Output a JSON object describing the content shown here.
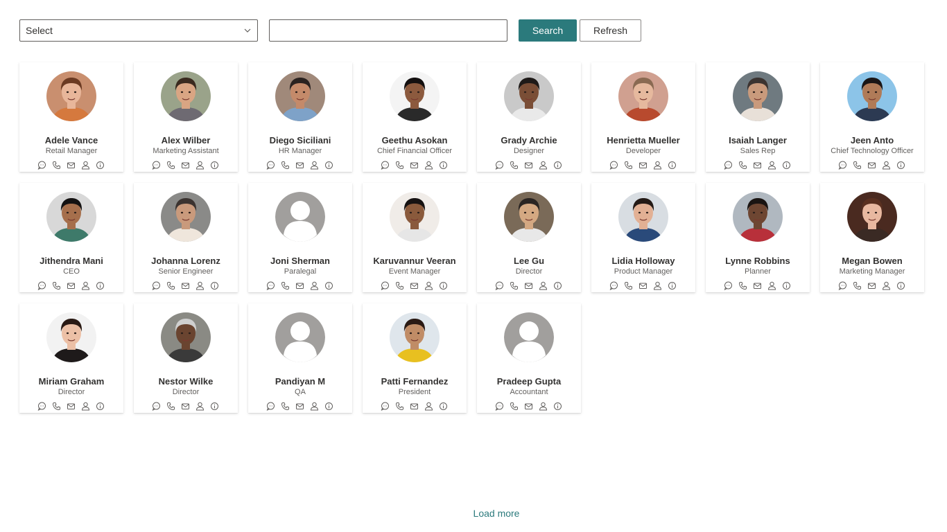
{
  "filter": {
    "select_label": "Select",
    "search_value": "",
    "search_button": "Search",
    "refresh_button": "Refresh"
  },
  "colors": {
    "accent": "#2b7a7c",
    "placeholder_avatar": "#a19f9d"
  },
  "card_actions": [
    "chat-icon",
    "phone-icon",
    "mail-icon",
    "person-icon",
    "info-icon"
  ],
  "people": [
    {
      "name": "Adele Vance",
      "role": "Retail Manager",
      "photo": true,
      "skin": "#e8b69a",
      "hair": "#6b3a22",
      "shirt": "#d5793e",
      "bg": "#c98f6f"
    },
    {
      "name": "Alex Wilber",
      "role": "Marketing Assistant",
      "photo": true,
      "skin": "#d9a583",
      "hair": "#3a2a1f",
      "shirt": "#6e6a72",
      "bg": "#9aa38a"
    },
    {
      "name": "Diego Siciliani",
      "role": "HR Manager",
      "photo": true,
      "skin": "#c48a6a",
      "hair": "#2a2220",
      "shirt": "#7ea2c8",
      "bg": "#a0897a"
    },
    {
      "name": "Geethu Asokan",
      "role": "Chief Financial Officer",
      "photo": true,
      "skin": "#8c5a3e",
      "hair": "#141010",
      "shirt": "#2a2a2a",
      "bg": "#f4f4f4"
    },
    {
      "name": "Grady Archie",
      "role": "Designer",
      "photo": true,
      "skin": "#7a4e36",
      "hair": "#1e1a18",
      "shirt": "#e9e9e9",
      "bg": "#c9c9c9"
    },
    {
      "name": "Henrietta Mueller",
      "role": "Developer",
      "photo": true,
      "skin": "#e6b99e",
      "hair": "#8a6a52",
      "shirt": "#b84a2e",
      "bg": "#d0a090"
    },
    {
      "name": "Isaiah Langer",
      "role": "Sales Rep",
      "photo": true,
      "skin": "#c99a7c",
      "hair": "#3b3330",
      "shirt": "#e8e0d8",
      "bg": "#6f7a80"
    },
    {
      "name": "Jeen Anto",
      "role": "Chief Technology Officer",
      "photo": true,
      "skin": "#b07b58",
      "hair": "#1a1616",
      "shirt": "#2c3a52",
      "bg": "#8cc4e8"
    },
    {
      "name": "Jithendra Mani",
      "role": "CEO",
      "photo": true,
      "skin": "#a66f4c",
      "hair": "#141212",
      "shirt": "#3e7a6a",
      "bg": "#d8d8d8"
    },
    {
      "name": "Johanna Lorenz",
      "role": "Senior Engineer",
      "photo": true,
      "skin": "#c99a7c",
      "hair": "#3b3330",
      "shirt": "#efe6dc",
      "bg": "#8a8a88"
    },
    {
      "name": "Joni Sherman",
      "role": "Paralegal",
      "photo": false
    },
    {
      "name": "Karuvannur Veeran",
      "role": "Event Manager",
      "photo": true,
      "skin": "#8a5a3c",
      "hair": "#161212",
      "shirt": "#e6e6e6",
      "bg": "#f0ece8"
    },
    {
      "name": "Lee Gu",
      "role": "Director",
      "photo": true,
      "skin": "#d4a882",
      "hair": "#2a2422",
      "shirt": "#e8e8e8",
      "bg": "#7a6a58"
    },
    {
      "name": "Lidia Holloway",
      "role": "Product Manager",
      "photo": true,
      "skin": "#e2b094",
      "hair": "#241a16",
      "shirt": "#2a4a7a",
      "bg": "#d8dde2"
    },
    {
      "name": "Lynne Robbins",
      "role": "Planner",
      "photo": true,
      "skin": "#6e4632",
      "hair": "#1a1412",
      "shirt": "#b8303a",
      "bg": "#b0b8c0"
    },
    {
      "name": "Megan Bowen",
      "role": "Marketing Manager",
      "photo": true,
      "skin": "#e8b8a0",
      "hair": "#5a3020",
      "shirt": "#3a2a24",
      "bg": "#4a2a20"
    },
    {
      "name": "Miriam Graham",
      "role": "Director",
      "photo": true,
      "skin": "#ecc0a6",
      "hair": "#2a1a14",
      "shirt": "#1e1a1a",
      "bg": "#f2f2f2"
    },
    {
      "name": "Nestor Wilke",
      "role": "Director",
      "photo": true,
      "skin": "#6a4430",
      "hair": "#cfcfcf",
      "shirt": "#3a3a3a",
      "bg": "#8a8a84"
    },
    {
      "name": "Pandiyan M",
      "role": "QA",
      "photo": false
    },
    {
      "name": "Patti Fernandez",
      "role": "President",
      "photo": true,
      "skin": "#c08c66",
      "hair": "#2a1a14",
      "shirt": "#e8c020",
      "bg": "#dfe6ec"
    },
    {
      "name": "Pradeep Gupta",
      "role": "Accountant",
      "photo": false
    }
  ],
  "load_more": "Load more"
}
